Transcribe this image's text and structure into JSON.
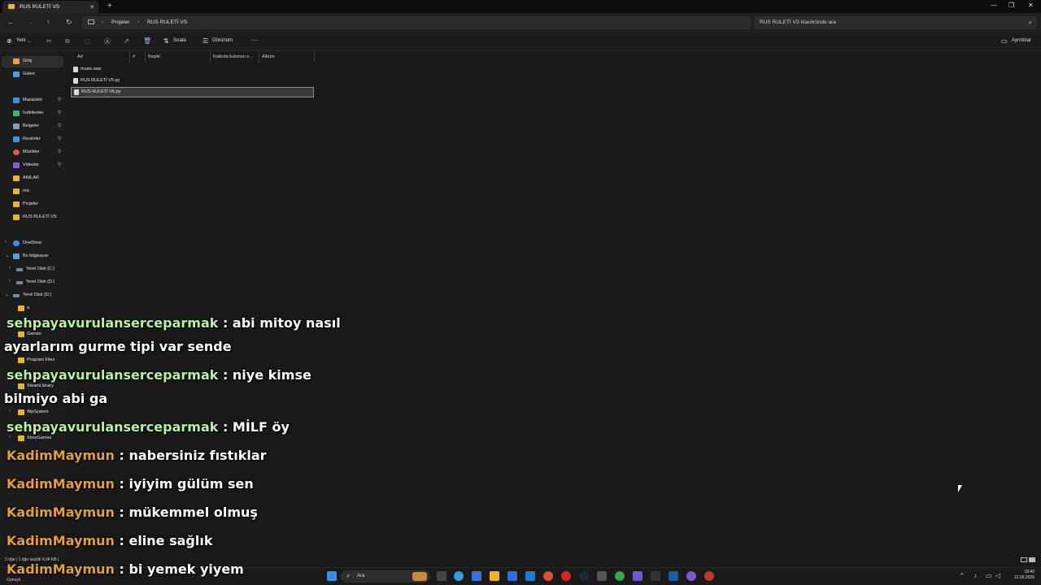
{
  "window": {
    "tab_label": "RUS RULETİ VS",
    "new_tab": "+",
    "close_tab": "×",
    "minimize": "—",
    "maximize": "❐",
    "close": "✕"
  },
  "addressbar": {
    "breadcrumbs": [
      "Projeler",
      "RUS RULETİ VS"
    ],
    "search_placeholder": "RUS RULETİ VS klasöründe ara"
  },
  "commandbar": {
    "new_label": "Yeni",
    "sort_label": "Sırala",
    "view_label": "Görünüm",
    "more_label": "···",
    "details_label": "Ayrıntılar"
  },
  "sidebar": {
    "top": [
      {
        "label": "Giriş",
        "selected": true
      },
      {
        "label": "Galeri",
        "selected": false
      }
    ],
    "quick": [
      {
        "label": "Masaüstü",
        "pinned": true
      },
      {
        "label": "İndirilenler",
        "pinned": true
      },
      {
        "label": "Belgeler",
        "pinned": true
      },
      {
        "label": "Resimler",
        "pinned": true
      },
      {
        "label": "Müzikler",
        "pinned": true
      },
      {
        "label": "Videolar",
        "pinned": true
      },
      {
        "label": "ANILAR",
        "pinned": false
      },
      {
        "label": "mic",
        "pinned": false
      },
      {
        "label": "Projeler",
        "pinned": false
      },
      {
        "label": "RUS RULETİ VS",
        "pinned": false
      }
    ],
    "tree": [
      {
        "label": "OneDrive"
      },
      {
        "label": "Bu bilgisayar"
      },
      {
        "label": "Yerel Disk (C:)"
      },
      {
        "label": "Yerel Disk (D:)"
      },
      {
        "label": "Yerel Disk (D:)"
      },
      {
        "label": "a"
      },
      {
        "label": "Games"
      },
      {
        "label": "Program Files"
      },
      {
        "label": "SteamLibrary"
      },
      {
        "label": "WpSystem"
      },
      {
        "label": "XboxGames"
      }
    ]
  },
  "filelist": {
    "columns": [
      "Ad",
      "#",
      "Başlık",
      "Katkıda bulunan s...",
      "Albüm"
    ],
    "files": [
      {
        "name": "music.wav",
        "selected": false
      },
      {
        "name": "RUS RULETİ V5.py",
        "selected": false
      },
      {
        "name": "RUS RULETİ V6.py",
        "selected": true
      }
    ]
  },
  "chat": [
    {
      "user": "sehpayavurulanserceparmak",
      "message": " : abi mitoy nasıl",
      "color": "#b8f29a"
    },
    {
      "user": "",
      "message": "ayarlarım gurme tipi var sende",
      "color": "#b8f29a"
    },
    {
      "user": "sehpayavurulanserceparmak",
      "message": " : niye kimse",
      "color": "#b8f29a"
    },
    {
      "user": "",
      "message": "bilmiyo abi ga",
      "color": "#b8f29a"
    },
    {
      "user": "sehpayavurulanserceparmak",
      "message": " : MİLF öy",
      "color": "#b8f29a"
    },
    {
      "user": "KadimMaymun",
      "message": " : nabersiniz fıstıklar",
      "color": "#e3a033"
    },
    {
      "user": "KadimMaymun",
      "message": " : iyiyim gülüm sen",
      "color": "#e3a033"
    },
    {
      "user": "KadimMaymun",
      "message": " : mükemmel olmuş",
      "color": "#e3a033"
    },
    {
      "user": "KadimMaymun",
      "message": " : eline sağlık",
      "color": "#e3a033"
    },
    {
      "user": "KadimMaymun",
      "message": " : bi yemek yiyem",
      "color": "#e3a033"
    }
  ],
  "statusbar": {
    "text": "3 öğe  |  1 öğe seçildi  6,04 KB  |"
  },
  "taskbar": {
    "search_label": "Ara",
    "weather": "Güneşli",
    "time": "18:40",
    "date": "12.05.2026"
  }
}
